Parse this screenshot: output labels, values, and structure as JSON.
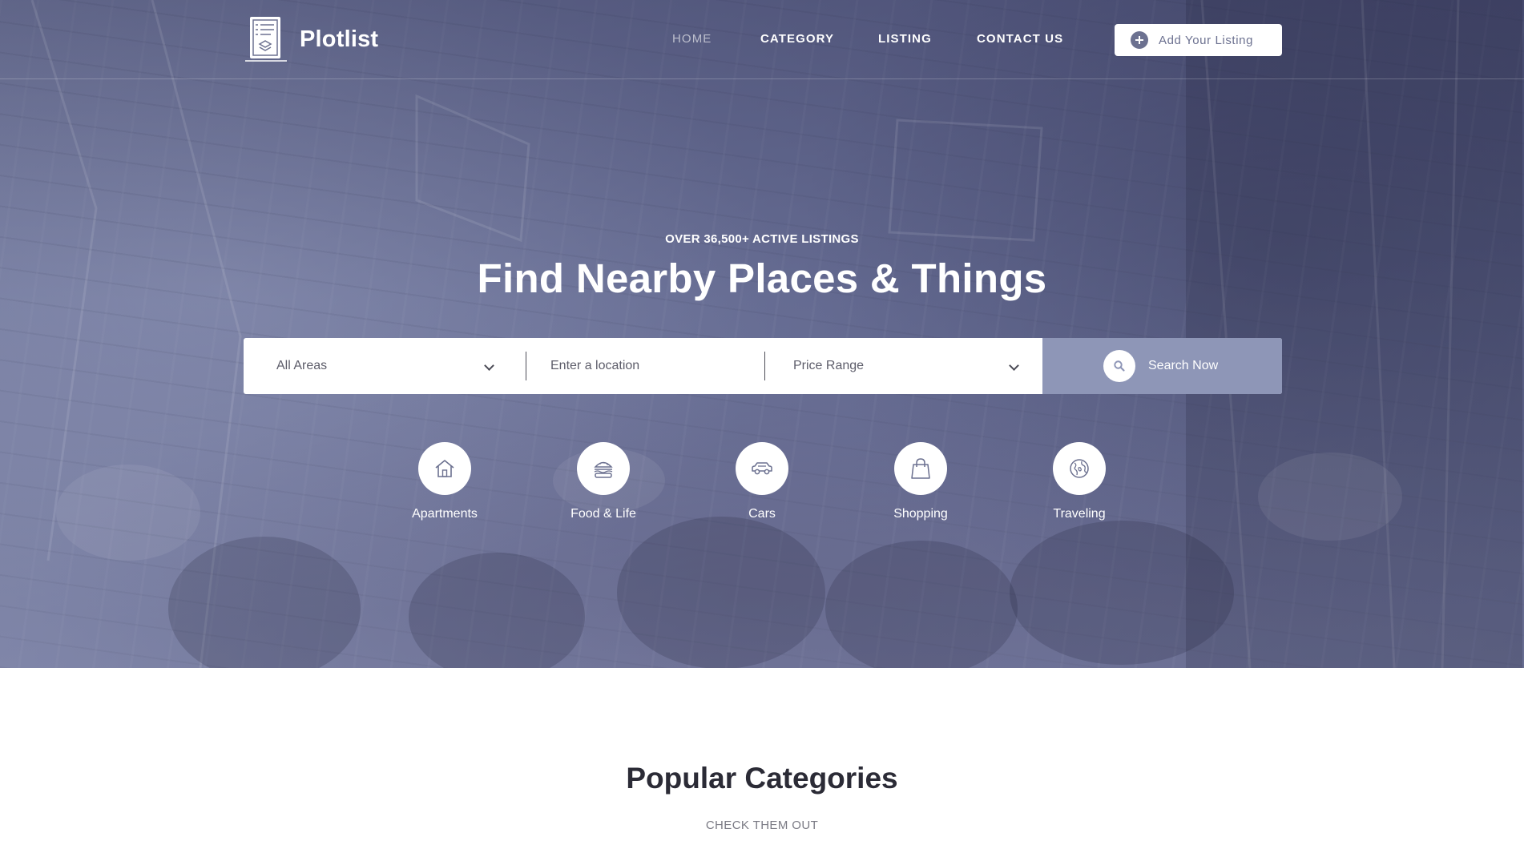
{
  "brand": {
    "name": "Plotlist",
    "logo_icon": "document-list-icon"
  },
  "nav": {
    "items": [
      {
        "label": "HOME",
        "active": true
      },
      {
        "label": "CATEGORY",
        "active": false
      },
      {
        "label": "LISTING",
        "active": false
      },
      {
        "label": "CONTACT US",
        "active": false
      }
    ],
    "add_listing_label": "Add Your Listing",
    "add_listing_icon": "plus-circle-icon"
  },
  "hero": {
    "eyebrow": "OVER 36,500+ ACTIVE LISTINGS",
    "title": "Find Nearby Places & Things"
  },
  "search": {
    "areas_selected": "All Areas",
    "location_placeholder": "Enter a location",
    "location_value": "",
    "price_selected": "Price Range",
    "button_label": "Search Now",
    "button_icon": "search-icon"
  },
  "categories": [
    {
      "label": "Apartments",
      "icon": "house-icon"
    },
    {
      "label": "Food & Life",
      "icon": "burger-icon"
    },
    {
      "label": "Cars",
      "icon": "car-icon"
    },
    {
      "label": "Shopping",
      "icon": "shopping-bag-icon"
    },
    {
      "label": "Traveling",
      "icon": "globe-icon"
    }
  ],
  "popular": {
    "title": "Popular Categories",
    "subtitle": "CHECK THEM OUT"
  },
  "colors": {
    "accent": "#8e96b7",
    "icon_gray": "#6c7190",
    "heading_dark": "#2b2b36"
  }
}
